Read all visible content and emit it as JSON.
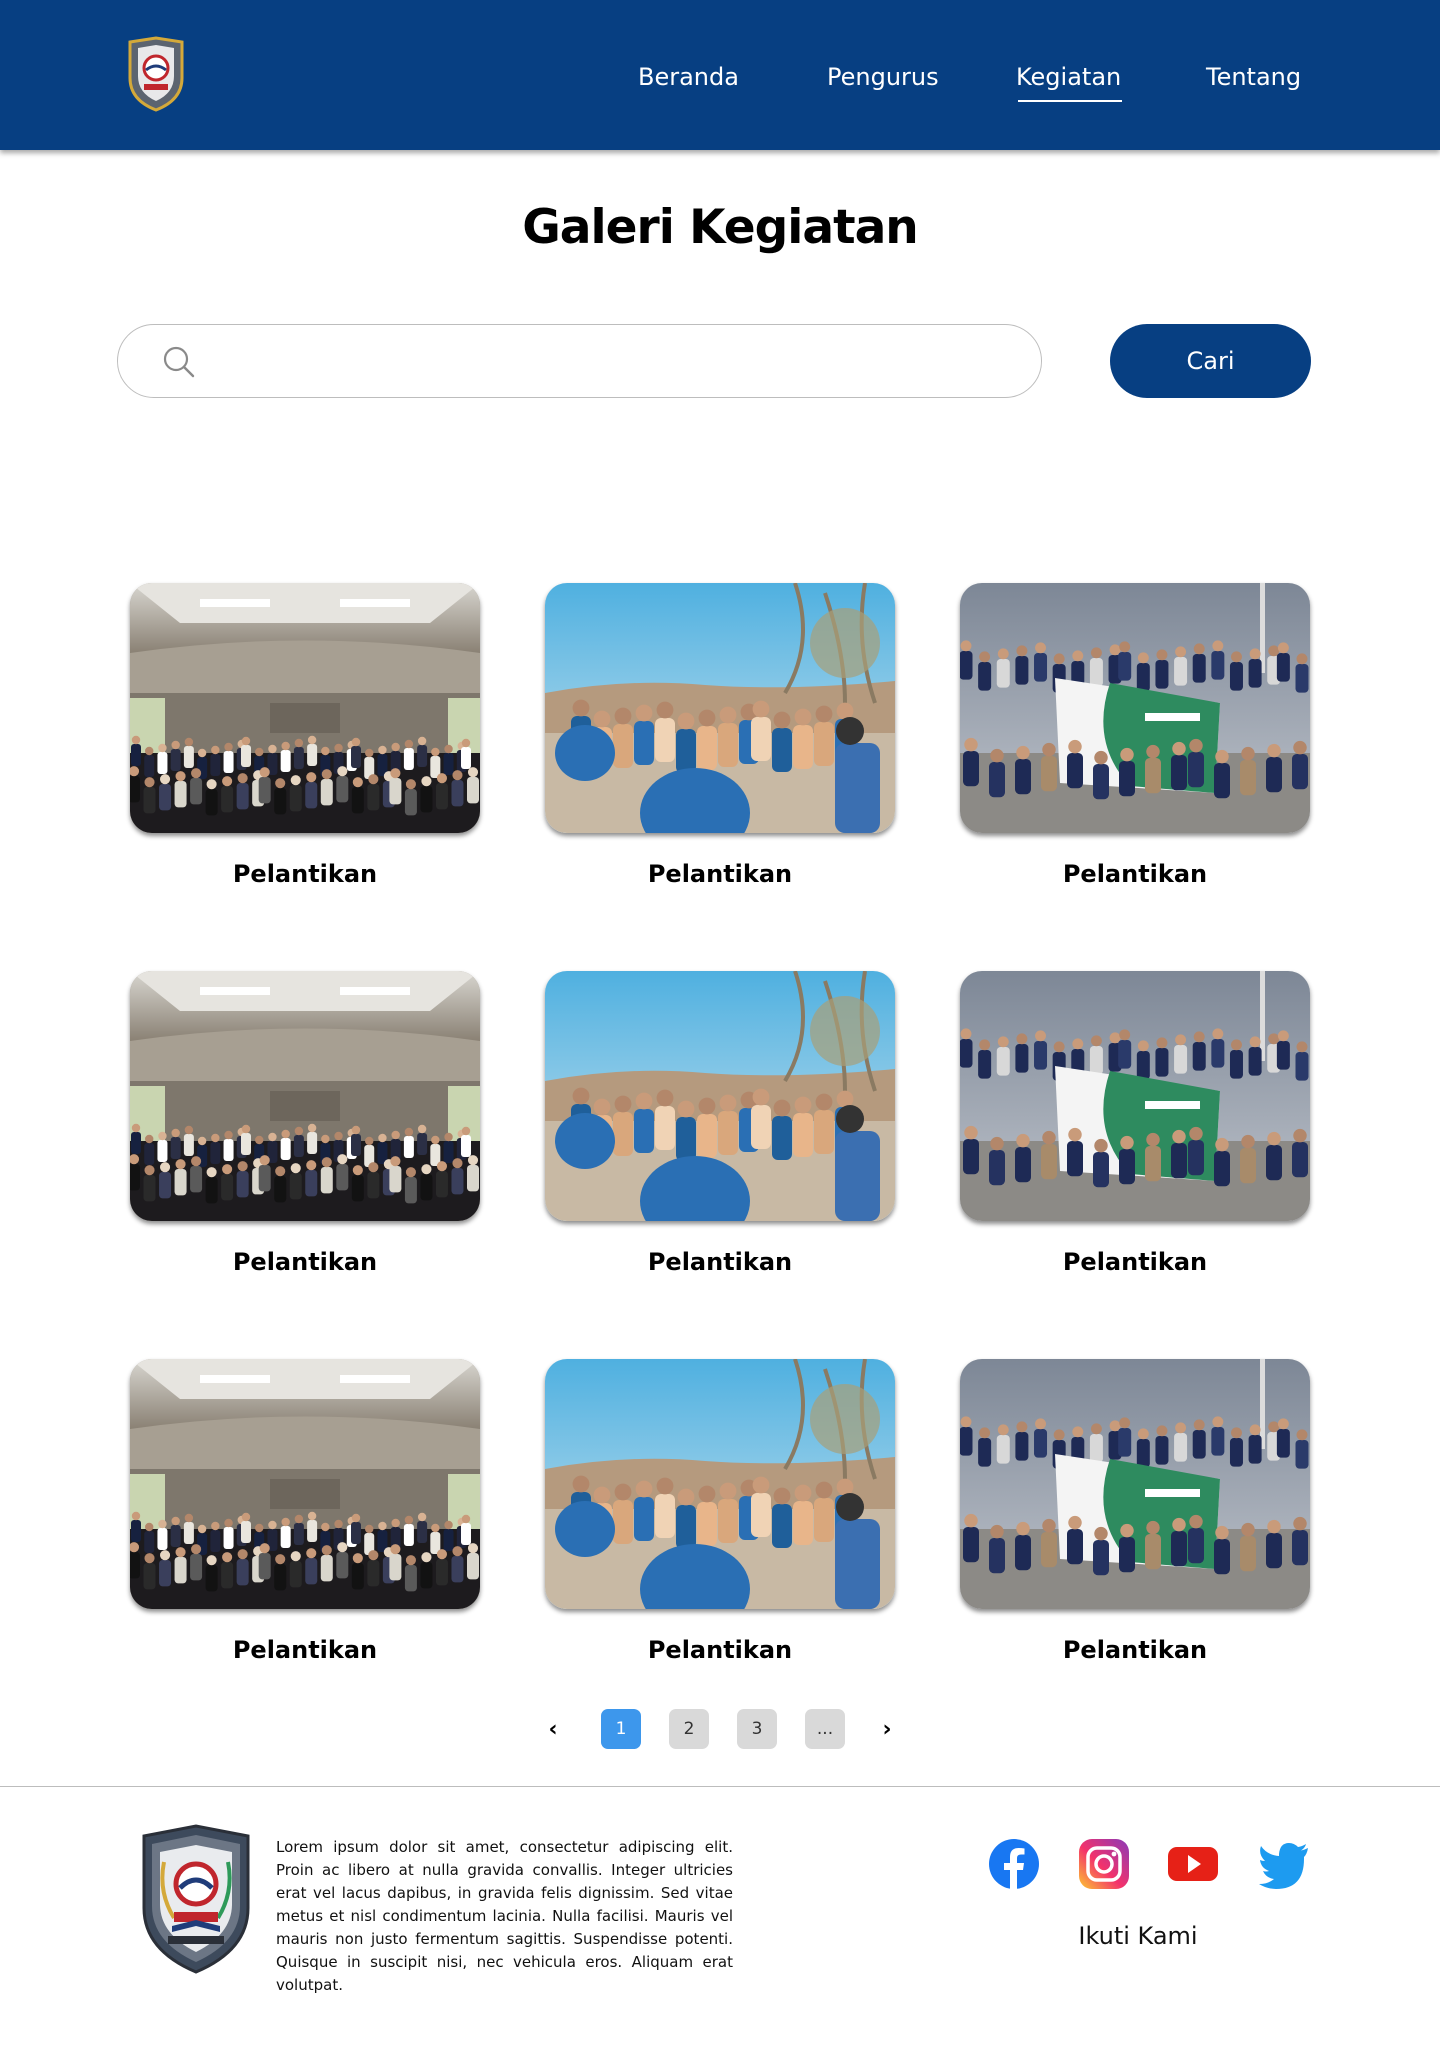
{
  "header": {
    "nav": [
      {
        "label": "Beranda"
      },
      {
        "label": "Pengurus"
      },
      {
        "label": "Kegiatan"
      },
      {
        "label": "Tentang"
      }
    ],
    "active_nav": "Kegiatan",
    "background": "#073f82"
  },
  "page": {
    "title": "Galeri Kegiatan"
  },
  "search": {
    "value": "",
    "placeholder": "",
    "button_label": "Cari"
  },
  "gallery": {
    "items": [
      {
        "caption": "Pelantikan",
        "photo": "hall-group-photo"
      },
      {
        "caption": "Pelantikan",
        "photo": "beach-activity-photo"
      },
      {
        "caption": "Pelantikan",
        "photo": "banner-group-photo"
      },
      {
        "caption": "Pelantikan",
        "photo": "hall-group-photo"
      },
      {
        "caption": "Pelantikan",
        "photo": "beach-activity-photo"
      },
      {
        "caption": "Pelantikan",
        "photo": "banner-group-photo"
      },
      {
        "caption": "Pelantikan",
        "photo": "hall-group-photo"
      },
      {
        "caption": "Pelantikan",
        "photo": "beach-activity-photo"
      },
      {
        "caption": "Pelantikan",
        "photo": "banner-group-photo"
      }
    ]
  },
  "pagination": {
    "prev": "‹",
    "next": "›",
    "pages": [
      "1",
      "2",
      "3",
      "..."
    ],
    "current": "1",
    "active_color": "#3d97ec"
  },
  "footer": {
    "description": "Lorem ipsum dolor sit amet, consectetur adipiscing elit. Proin ac libero at nulla gravida convallis. Integer ultricies erat vel lacus dapibus, in gravida felis dignissim. Sed vitae metus et nisl condimentum lacinia. Nulla facilisi. Mauris vel mauris non justo fermentum sagittis. Suspendisse potenti. Quisque in suscipit nisi, nec vehicula eros. Aliquam erat volutpat.",
    "social_icons": [
      "facebook-icon",
      "instagram-icon",
      "youtube-icon",
      "twitter-icon"
    ],
    "follow_label": "Ikuti Kami"
  }
}
